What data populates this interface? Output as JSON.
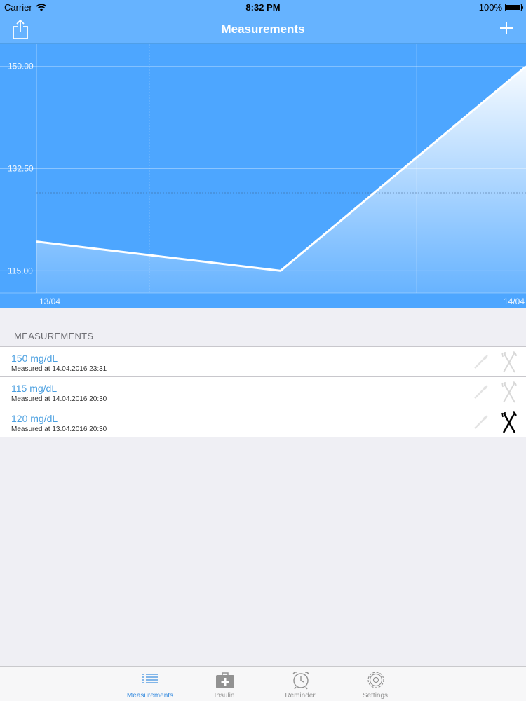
{
  "status": {
    "carrier": "Carrier",
    "time": "8:32 PM",
    "battery": "100%"
  },
  "nav": {
    "title": "Measurements"
  },
  "chart_data": {
    "type": "line",
    "x": [
      "13/04 20:30",
      "14/04 20:30",
      "14/04 23:31"
    ],
    "values": [
      120,
      115,
      150
    ],
    "ytick_labels": [
      "150.00",
      "132.50",
      "115.00"
    ],
    "yticks": [
      150,
      132.5,
      115
    ],
    "xtick_labels": [
      "13/04",
      "14/04"
    ],
    "reference_line": 128.3,
    "ylim": [
      111.2,
      153.8
    ],
    "grid": true,
    "colors": {
      "background": "#4da6ff",
      "line": "#ffffff"
    }
  },
  "section": {
    "header": "MEASUREMENTS"
  },
  "measurements": [
    {
      "value": "150 mg/dL",
      "measured": "Measured at 14.04.2016 23:31",
      "meal_active": false
    },
    {
      "value": "115 mg/dL",
      "measured": "Measured at 14.04.2016 20:30",
      "meal_active": false
    },
    {
      "value": "120 mg/dL",
      "measured": "Measured at 13.04.2016 20:30",
      "meal_active": true
    }
  ],
  "tabs": [
    {
      "label": "Measurements",
      "icon": "list-icon",
      "active": true
    },
    {
      "label": "Insulin",
      "icon": "medkit-icon",
      "active": false
    },
    {
      "label": "Reminder",
      "icon": "alarm-clock-icon",
      "active": false
    },
    {
      "label": "Settings",
      "icon": "gear-icon",
      "active": false
    }
  ]
}
